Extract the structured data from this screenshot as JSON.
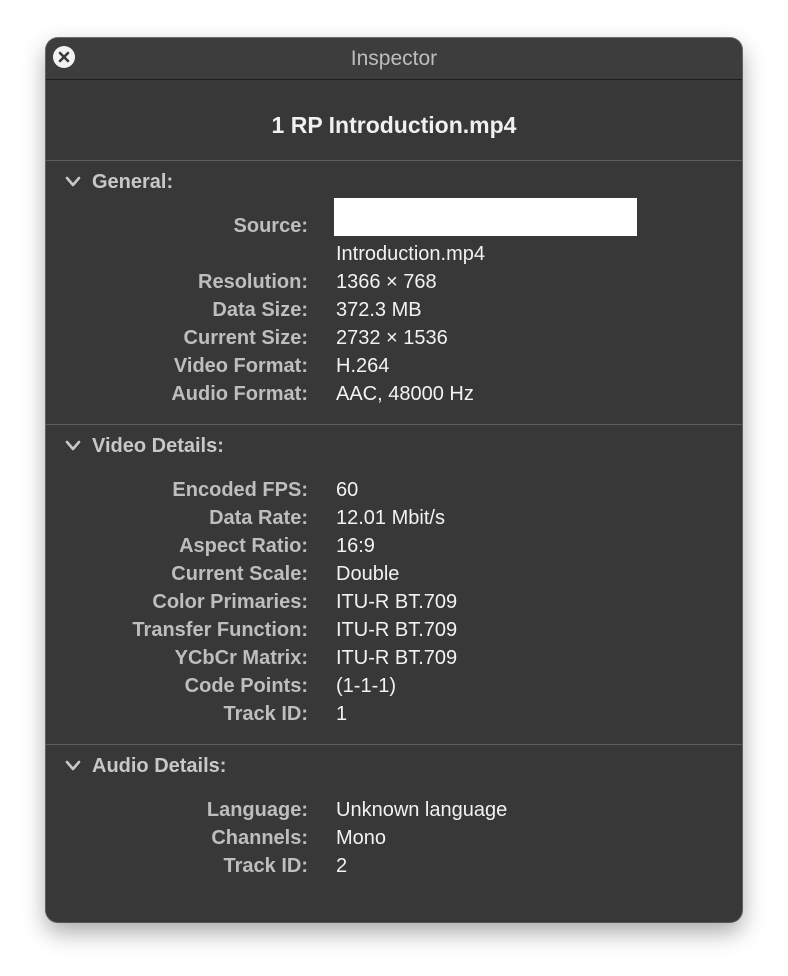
{
  "window": {
    "title": "Inspector",
    "close_icon": "close-icon"
  },
  "file": {
    "name": "1 RP Introduction.mp4"
  },
  "general": {
    "title": "General:",
    "rows": [
      {
        "label": "Source:",
        "value": ""
      },
      {
        "label": "",
        "value": "Introduction.mp4"
      },
      {
        "label": "Resolution:",
        "value": "1366 × 768"
      },
      {
        "label": "Data Size:",
        "value": "372.3 MB"
      },
      {
        "label": "Current Size:",
        "value": "2732 × 1536"
      },
      {
        "label": "Video Format:",
        "value": "H.264"
      },
      {
        "label": "Audio Format:",
        "value": "AAC, 48000 Hz"
      }
    ]
  },
  "video_details": {
    "title": "Video Details:",
    "rows": [
      {
        "label": "Encoded FPS:",
        "value": "60"
      },
      {
        "label": "Data Rate:",
        "value": "12.01 Mbit/s"
      },
      {
        "label": "Aspect Ratio:",
        "value": "16:9"
      },
      {
        "label": "Current Scale:",
        "value": "Double"
      },
      {
        "label": "Color Primaries:",
        "value": "ITU-R BT.709"
      },
      {
        "label": "Transfer Function:",
        "value": "ITU-R BT.709"
      },
      {
        "label": "YCbCr Matrix:",
        "value": "ITU-R BT.709"
      },
      {
        "label": "Code Points:",
        "value": "(1-1-1)"
      },
      {
        "label": "Track ID:",
        "value": "1"
      }
    ]
  },
  "audio_details": {
    "title": "Audio Details:",
    "rows": [
      {
        "label": "Language:",
        "value": "Unknown language"
      },
      {
        "label": "Channels:",
        "value": "Mono"
      },
      {
        "label": "Track ID:",
        "value": "2"
      }
    ]
  },
  "colors": {
    "window_bg": "#383838",
    "label": "#bebebe",
    "value": "#f2f2f2"
  }
}
